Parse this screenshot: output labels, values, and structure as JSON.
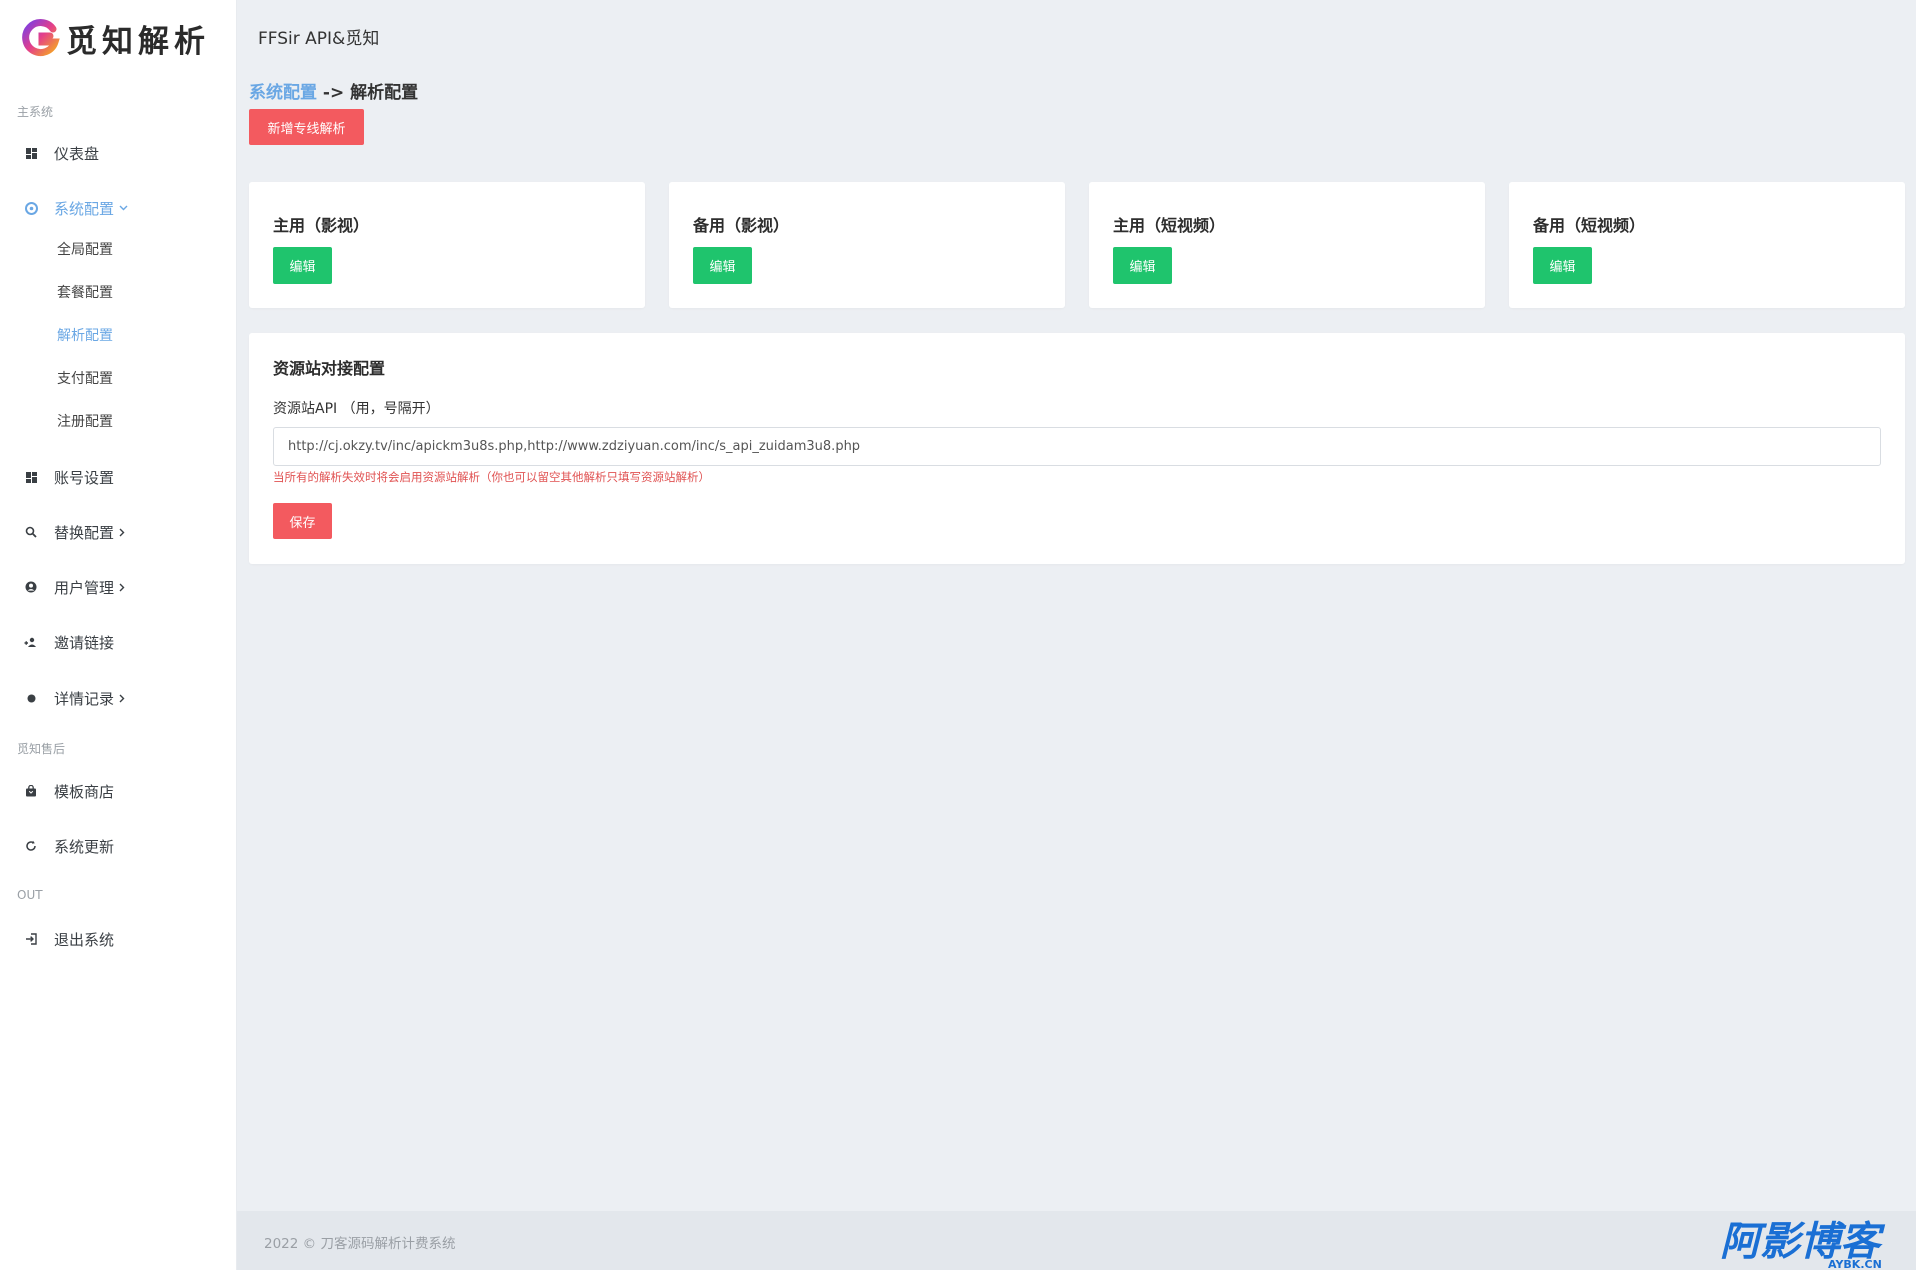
{
  "brand": {
    "logo_text": "觅知解析"
  },
  "header": {
    "title": "FFSir API&觅知"
  },
  "sidebar": {
    "sections": [
      "主系统",
      "觅知售后",
      "OUT"
    ],
    "items": [
      {
        "label": "仪表盘",
        "icon": "dashboard-icon"
      },
      {
        "label": "系统配置",
        "icon": "system-config-icon"
      },
      {
        "label": "账号设置",
        "icon": "dashboard-icon"
      },
      {
        "label": "替换配置",
        "icon": "search-icon"
      },
      {
        "label": "用户管理",
        "icon": "user-icon"
      },
      {
        "label": "邀请链接",
        "icon": "invite-icon"
      },
      {
        "label": "详情记录",
        "icon": "dot-icon"
      },
      {
        "label": "模板商店",
        "icon": "bag-icon"
      },
      {
        "label": "系统更新",
        "icon": "refresh-icon"
      },
      {
        "label": "退出系统",
        "icon": "logout-icon"
      }
    ],
    "sub_items": [
      "全局配置",
      "套餐配置",
      "解析配置",
      "支付配置",
      "注册配置"
    ],
    "active_item": "系统配置",
    "active_sub_item": "解析配置"
  },
  "breadcrumb": {
    "parent": "系统配置",
    "separator": " -> ",
    "current": "解析配置"
  },
  "actions": {
    "new_line_label": "新增专线解析"
  },
  "parse_cards": [
    {
      "title": "主用（影视）",
      "button": "编辑"
    },
    {
      "title": "备用（影视）",
      "button": "编辑"
    },
    {
      "title": "主用（短视频）",
      "button": "编辑"
    },
    {
      "title": "备用（短视频）",
      "button": "编辑"
    }
  ],
  "resource_config": {
    "title": "资源站对接配置",
    "api_label": "资源站API （用，号隔开）",
    "api_value": "http://cj.okzy.tv/inc/apickm3u8s.php,http://www.zdziyuan.com/inc/s_api_zuidam3u8.php",
    "hint": "当所有的解析失效时将会启用资源站解析（你也可以留空其他解析只填写资源站解析）",
    "save_label": "保存"
  },
  "footer": {
    "text": "2022 © 刀客源码解析计费系统"
  },
  "watermark": {
    "text": "阿影博客",
    "subtext": "AYBK.CN"
  },
  "colors": {
    "accent": "#6aa7e4",
    "danger": "#f35a5f",
    "success": "#1fc46d",
    "hint": "#e05252"
  }
}
